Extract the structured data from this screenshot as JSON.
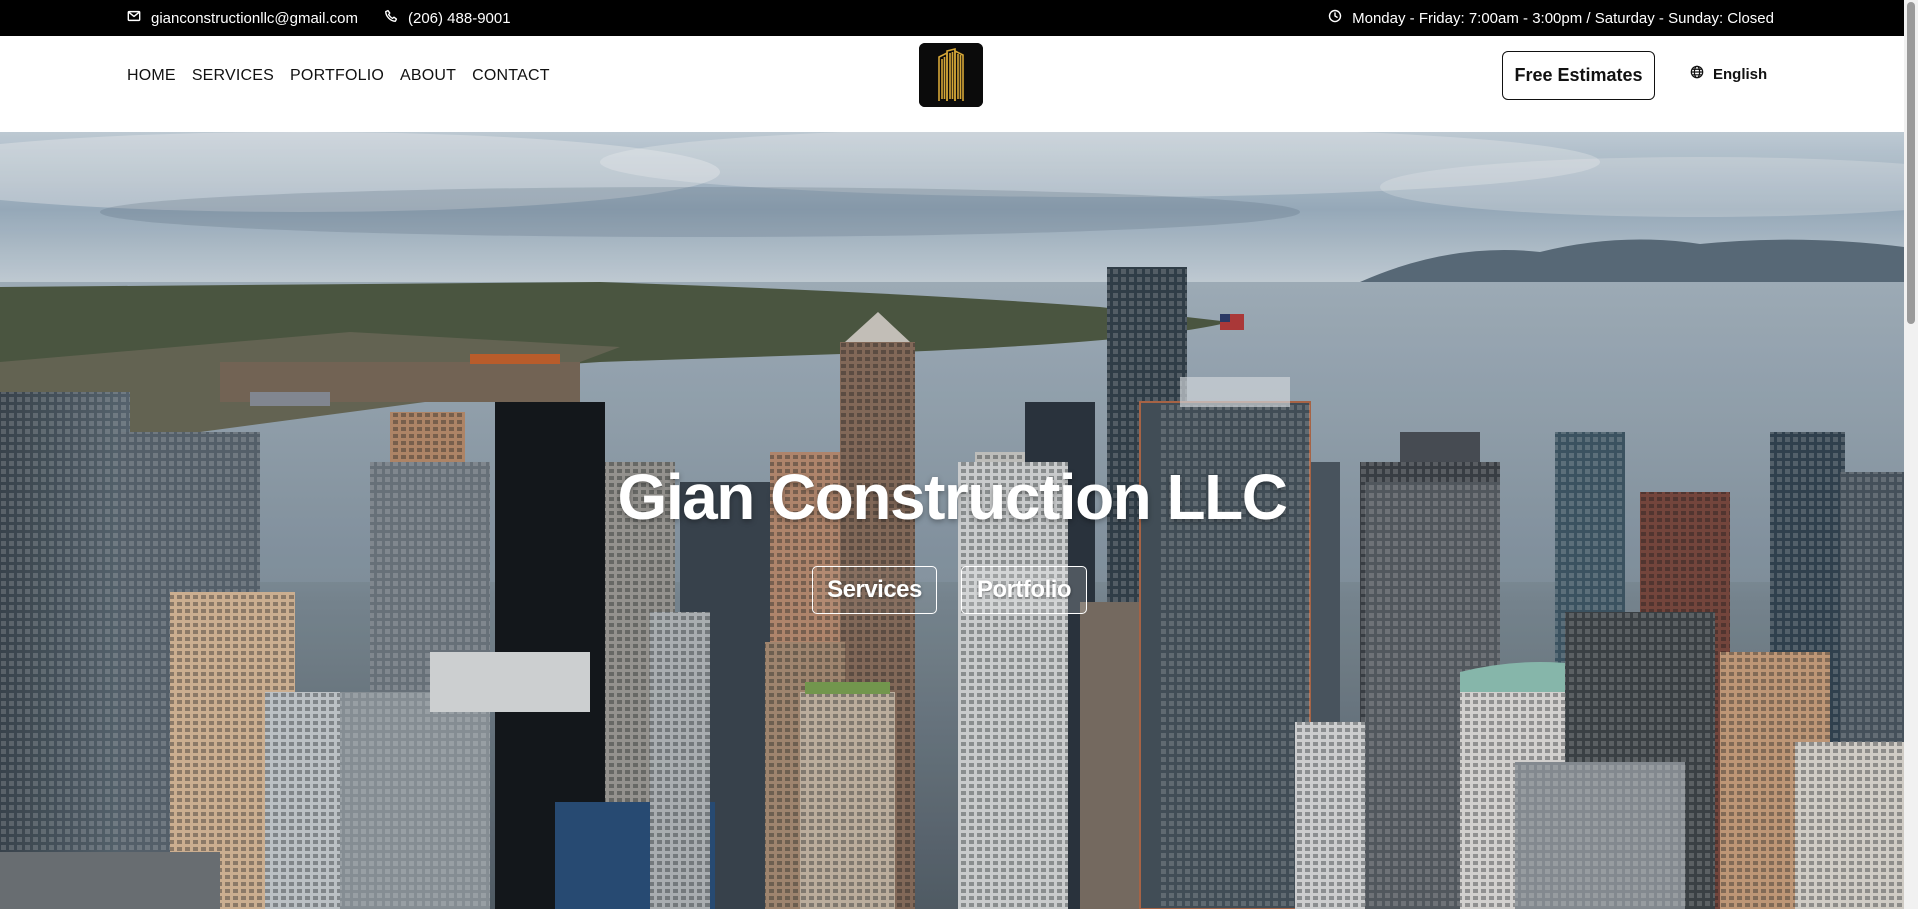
{
  "topbar": {
    "email": "gianconstructionllc@gmail.com",
    "phone": "(206) 488-9001",
    "hours": "Monday - Friday: 7:00am - 3:00pm / Saturday - Sunday: Closed",
    "icons": {
      "email": "mail-icon",
      "phone": "phone-icon",
      "hours": "clock-icon"
    }
  },
  "nav": {
    "links": [
      "HOME",
      "SERVICES",
      "PORTFOLIO",
      "ABOUT",
      "CONTACT"
    ],
    "cta_label": "Free Estimates",
    "language": "English"
  },
  "hero": {
    "title": "Gian Construction LLC",
    "buttons": [
      "Services",
      "Portfolio"
    ]
  },
  "colors": {
    "topbar_bg": "#000000",
    "nav_bg": "#ffffff",
    "logo_bg": "#0b0b0b",
    "logo_accent": "#d4a637",
    "text_dark": "#111111",
    "hero_text": "#ffffff"
  }
}
